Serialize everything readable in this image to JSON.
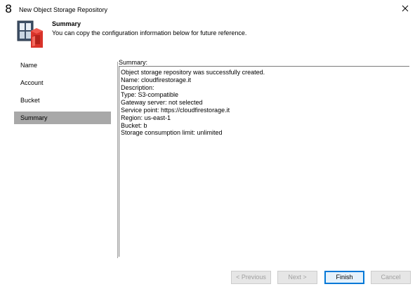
{
  "window": {
    "title": "New Object Storage Repository",
    "glyph": "8"
  },
  "header": {
    "title": "Summary",
    "subtitle": "You can copy the configuration information below for future reference.",
    "icon": "object-storage-icon"
  },
  "nav": {
    "items": [
      {
        "label": "Name"
      },
      {
        "label": "Account"
      },
      {
        "label": "Bucket"
      },
      {
        "label": "Summary",
        "selected": true
      }
    ]
  },
  "summary": {
    "label": "Summary:",
    "lines": [
      "Object storage repository was successfully created.",
      "Name: cloudfirestorage.it",
      "Description:",
      "Type: S3-compatible",
      "Gateway server: not selected",
      "Service point: https://cloudfirestorage.it",
      "Region: us-east-1",
      "Bucket: b",
      "Storage consumption limit: unlimited"
    ]
  },
  "buttons": {
    "previous": "< Previous",
    "next": "Next >",
    "finish": "Finish",
    "cancel": "Cancel"
  },
  "colors": {
    "selected_nav": "#a8a8a8",
    "accent": "#0078d7",
    "disabled_text": "#a0a0a0"
  }
}
